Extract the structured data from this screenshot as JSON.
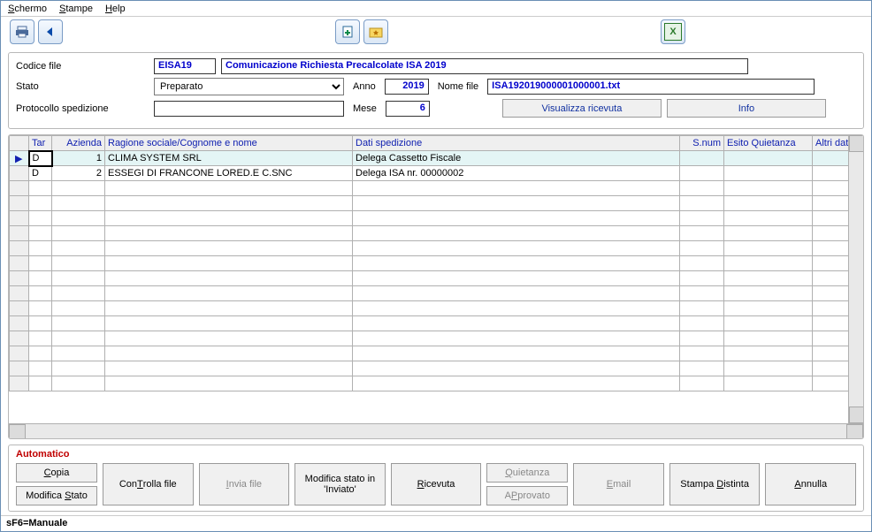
{
  "menu": {
    "schermo": "Schermo",
    "stampe": "Stampe",
    "help": "Help"
  },
  "header": {
    "codice_file_lbl": "Codice file",
    "codice_file_val": "EISA19",
    "descr": "Comunicazione Richiesta Precalcolate ISA 2019",
    "stato_lbl": "Stato",
    "stato_val": "Preparato",
    "anno_lbl": "Anno",
    "anno_val": "2019",
    "nomefile_lbl": "Nome file",
    "nomefile_val": "ISA192019000001000001.txt",
    "prot_lbl": "Protocollo spedizione",
    "prot_val": "",
    "mese_lbl": "Mese",
    "mese_val": "6",
    "visualizza_btn": "Visualizza ricevuta",
    "info_btn": "Info"
  },
  "grid": {
    "cols": [
      "",
      "Tar",
      "Azienda",
      "Ragione sociale/Cognome e nome",
      "Dati spedizione",
      "S.num",
      "Esito Quietanza",
      "Altri dati spediz"
    ],
    "rows": [
      {
        "marker": "▶",
        "tar": "D",
        "azienda": "1",
        "ragione": "CLIMA SYSTEM SRL",
        "dati": "Delega Cassetto Fiscale",
        "snum": "",
        "esito": "",
        "altri": ""
      },
      {
        "marker": "",
        "tar": "D",
        "azienda": "2",
        "ragione": "ESSEGI DI FRANCONE LORED.E C.SNC",
        "dati": "Delega ISA nr. 00000002",
        "snum": "",
        "esito": "",
        "altri": ""
      }
    ]
  },
  "bottom": {
    "auto": "Automatico",
    "copia": "Copia",
    "modstato": "Modifica Stato",
    "controlla": "ConTrolla file",
    "invia": "Invia file",
    "modinviato_l1": "Modifica stato in",
    "modinviato_l2": "'Inviato'",
    "ricevuta": "Ricevuta",
    "quietanza": "Quietanza",
    "approvato": "APprovato",
    "email": "Email",
    "stampa": "Stampa Distinta",
    "annulla": "Annulla"
  },
  "status": "sF6=Manuale"
}
